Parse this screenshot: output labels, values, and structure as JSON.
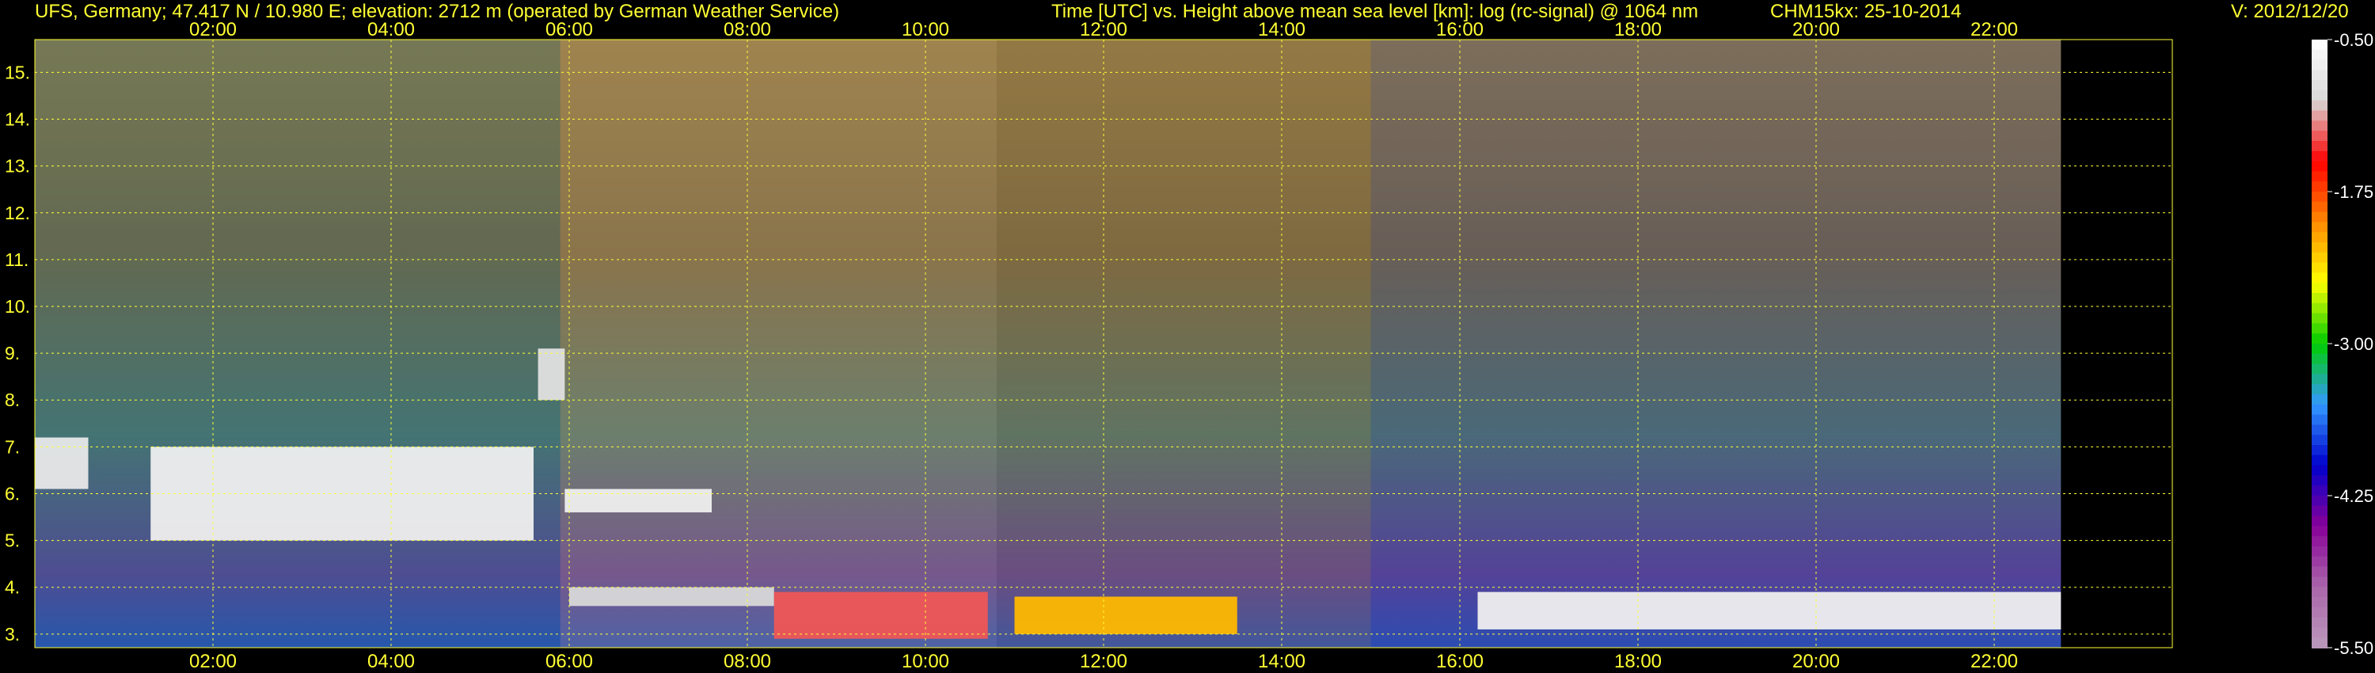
{
  "header": {
    "station": "UFS, Germany; 47.417 N / 10.980 E; elevation: 2712 m  (operated by German Weather Service)",
    "axes": "Time [UTC] vs. Height above mean sea level [km]: log (rc-signal) @ 1064 nm",
    "instrument": "CHM15kx: 25-10-2014",
    "version": "V: 2012/12/20"
  },
  "chart_data": {
    "type": "heatmap",
    "title": "Time [UTC] vs. Height above mean sea level [km]: log (rc-signal) @ 1064 nm",
    "xlabel": "Time [UTC]",
    "ylabel": "Height above mean sea level [km]",
    "x_ticks": [
      "02:00",
      "04:00",
      "06:00",
      "08:00",
      "10:00",
      "12:00",
      "14:00",
      "16:00",
      "18:00",
      "20:00",
      "22:00"
    ],
    "x_tick_hours": [
      2,
      4,
      6,
      8,
      10,
      12,
      14,
      16,
      18,
      20,
      22
    ],
    "x_range_hours": [
      0,
      24
    ],
    "data_end_hour": 22.75,
    "y_ticks": [
      "3.",
      "4.",
      "5.",
      "6.",
      "7.",
      "8.",
      "9.",
      "10.",
      "11.",
      "12.",
      "13.",
      "14.",
      "15."
    ],
    "y_tick_values": [
      3,
      4,
      5,
      6,
      7,
      8,
      9,
      10,
      11,
      12,
      13,
      14,
      15
    ],
    "y_range_km": [
      2.71,
      15.7
    ],
    "grid": true,
    "colorbar": {
      "labels": [
        "-0.50",
        "-1.75",
        "-3.00",
        "-4.25",
        "-5.50"
      ],
      "values": [
        -0.5,
        -1.75,
        -3.0,
        -4.25,
        -5.5
      ],
      "range": [
        -5.5,
        -0.5
      ],
      "colors": [
        "#ffffff",
        "#d8d8d8",
        "#ff0000",
        "#ff8800",
        "#ffff00",
        "#00cc00",
        "#3399ff",
        "#0000cc",
        "#880099",
        "#aa66aa",
        "#bb99bb"
      ]
    },
    "features": [
      {
        "feature": "cloud layer",
        "start_hour": 0.0,
        "end_hour": 0.6,
        "base_km": 6.1,
        "top_km": 7.2,
        "level": -0.8
      },
      {
        "feature": "cloud layer",
        "start_hour": 1.3,
        "end_hour": 5.6,
        "base_km": 5.0,
        "top_km": 7.0,
        "level": -0.7
      },
      {
        "feature": "cloud patch",
        "start_hour": 5.65,
        "end_hour": 5.95,
        "base_km": 8.0,
        "top_km": 9.1,
        "level": -0.9
      },
      {
        "feature": "cloud layer",
        "start_hour": 5.95,
        "end_hour": 7.6,
        "base_km": 5.6,
        "top_km": 6.1,
        "level": -0.7
      },
      {
        "feature": "boundary layer top",
        "start_hour": 6.0,
        "end_hour": 8.3,
        "base_km": 3.6,
        "top_km": 4.0,
        "level": -1.0
      },
      {
        "feature": "boundary layer convection",
        "start_hour": 8.3,
        "end_hour": 10.7,
        "base_km": 2.9,
        "top_km": 3.9,
        "level": -1.3
      },
      {
        "feature": "boundary layer convection",
        "start_hour": 11.0,
        "end_hour": 13.5,
        "base_km": 3.0,
        "top_km": 3.8,
        "level": -2.2
      },
      {
        "feature": "boundary layer top",
        "start_hour": 16.2,
        "end_hour": 22.75,
        "base_km": 3.1,
        "top_km": 3.9,
        "level": -0.7
      }
    ]
  }
}
